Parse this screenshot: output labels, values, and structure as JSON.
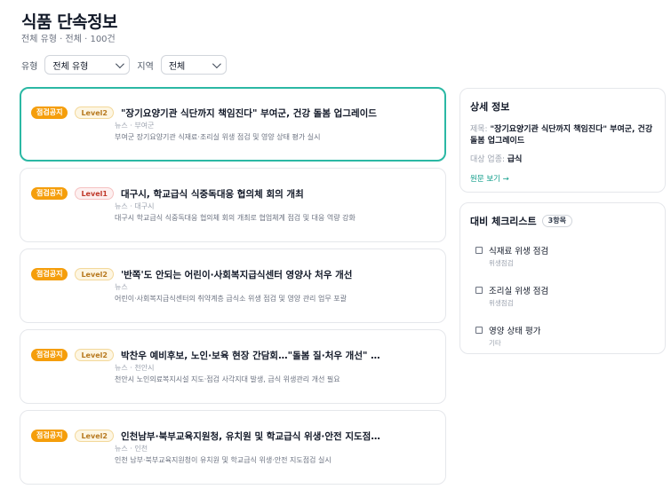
{
  "header": {
    "title": "식품 단속정보",
    "subtitle": "전체 유형 · 전체 · 100건"
  },
  "filters": {
    "type_label": "유형",
    "type_value": "전체 유형",
    "region_label": "지역",
    "region_value": "전체"
  },
  "items": [
    {
      "badge": "점검공지",
      "level": "Level2",
      "title": "\"장기요양기관 식단까지 책임진다\" 부여군, 건강 돌봄 업그레이드",
      "meta": "뉴스 · 부여군",
      "desc": "부여군 장기요양기관 식재료·조리실 위생 점검 및 영양 상태 평가 실시"
    },
    {
      "badge": "점검공지",
      "level": "Level1",
      "title": "대구시, 학교급식 식중독대응 협의체 회의 개최",
      "meta": "뉴스 · 대구시",
      "desc": "대구시 학교급식 식중독대응 협의체 회의 개최로 협업체계 점검 및 대응 역량 강화"
    },
    {
      "badge": "점검공지",
      "level": "Level2",
      "title": "'반쪽'도 안되는 어린이·사회복지급식센터 영양사 처우 개선",
      "meta": "뉴스",
      "desc": "어린이·사회복지급식센터의 취약계층 급식소 위생 점검 및 영양 관리 업무 포괄"
    },
    {
      "badge": "점검공지",
      "level": "Level2",
      "title": "박찬우 예비후보, 노인·보육 현장 간담회…\"돌봄 질·처우 개선\" 강...",
      "meta": "뉴스 · 천안시",
      "desc": "천안시 노인의료복지시설 지도·점검 사각지대 발생, 급식 위생관리 개선 필요"
    },
    {
      "badge": "점검공지",
      "level": "Level2",
      "title": "인천남부·북부교육지원청, 유치원 및 학교급식 위생·안전 지도점검 실...",
      "meta": "뉴스 · 인천",
      "desc": "인천 남부·북부교육지원청이 유치원 및 학교급식 위생·안전 지도점검 실시"
    }
  ],
  "detail": {
    "title": "상세 정보",
    "title_key": "제목:",
    "title_value": "\"장기요양기관 식단까지 책임진다\" 부여군, 건강 돌봄 업그레이드",
    "industry_key": "대상 업종:",
    "industry_value": "급식",
    "link": "원문 보기 →"
  },
  "checklist": {
    "title": "대비 체크리스트",
    "count": "3항목",
    "items": [
      {
        "label": "식재료 위생 점검",
        "category": "위생점검"
      },
      {
        "label": "조리실 위생 점검",
        "category": "위생점검"
      },
      {
        "label": "영양 상태 평가",
        "category": "기타"
      }
    ]
  }
}
